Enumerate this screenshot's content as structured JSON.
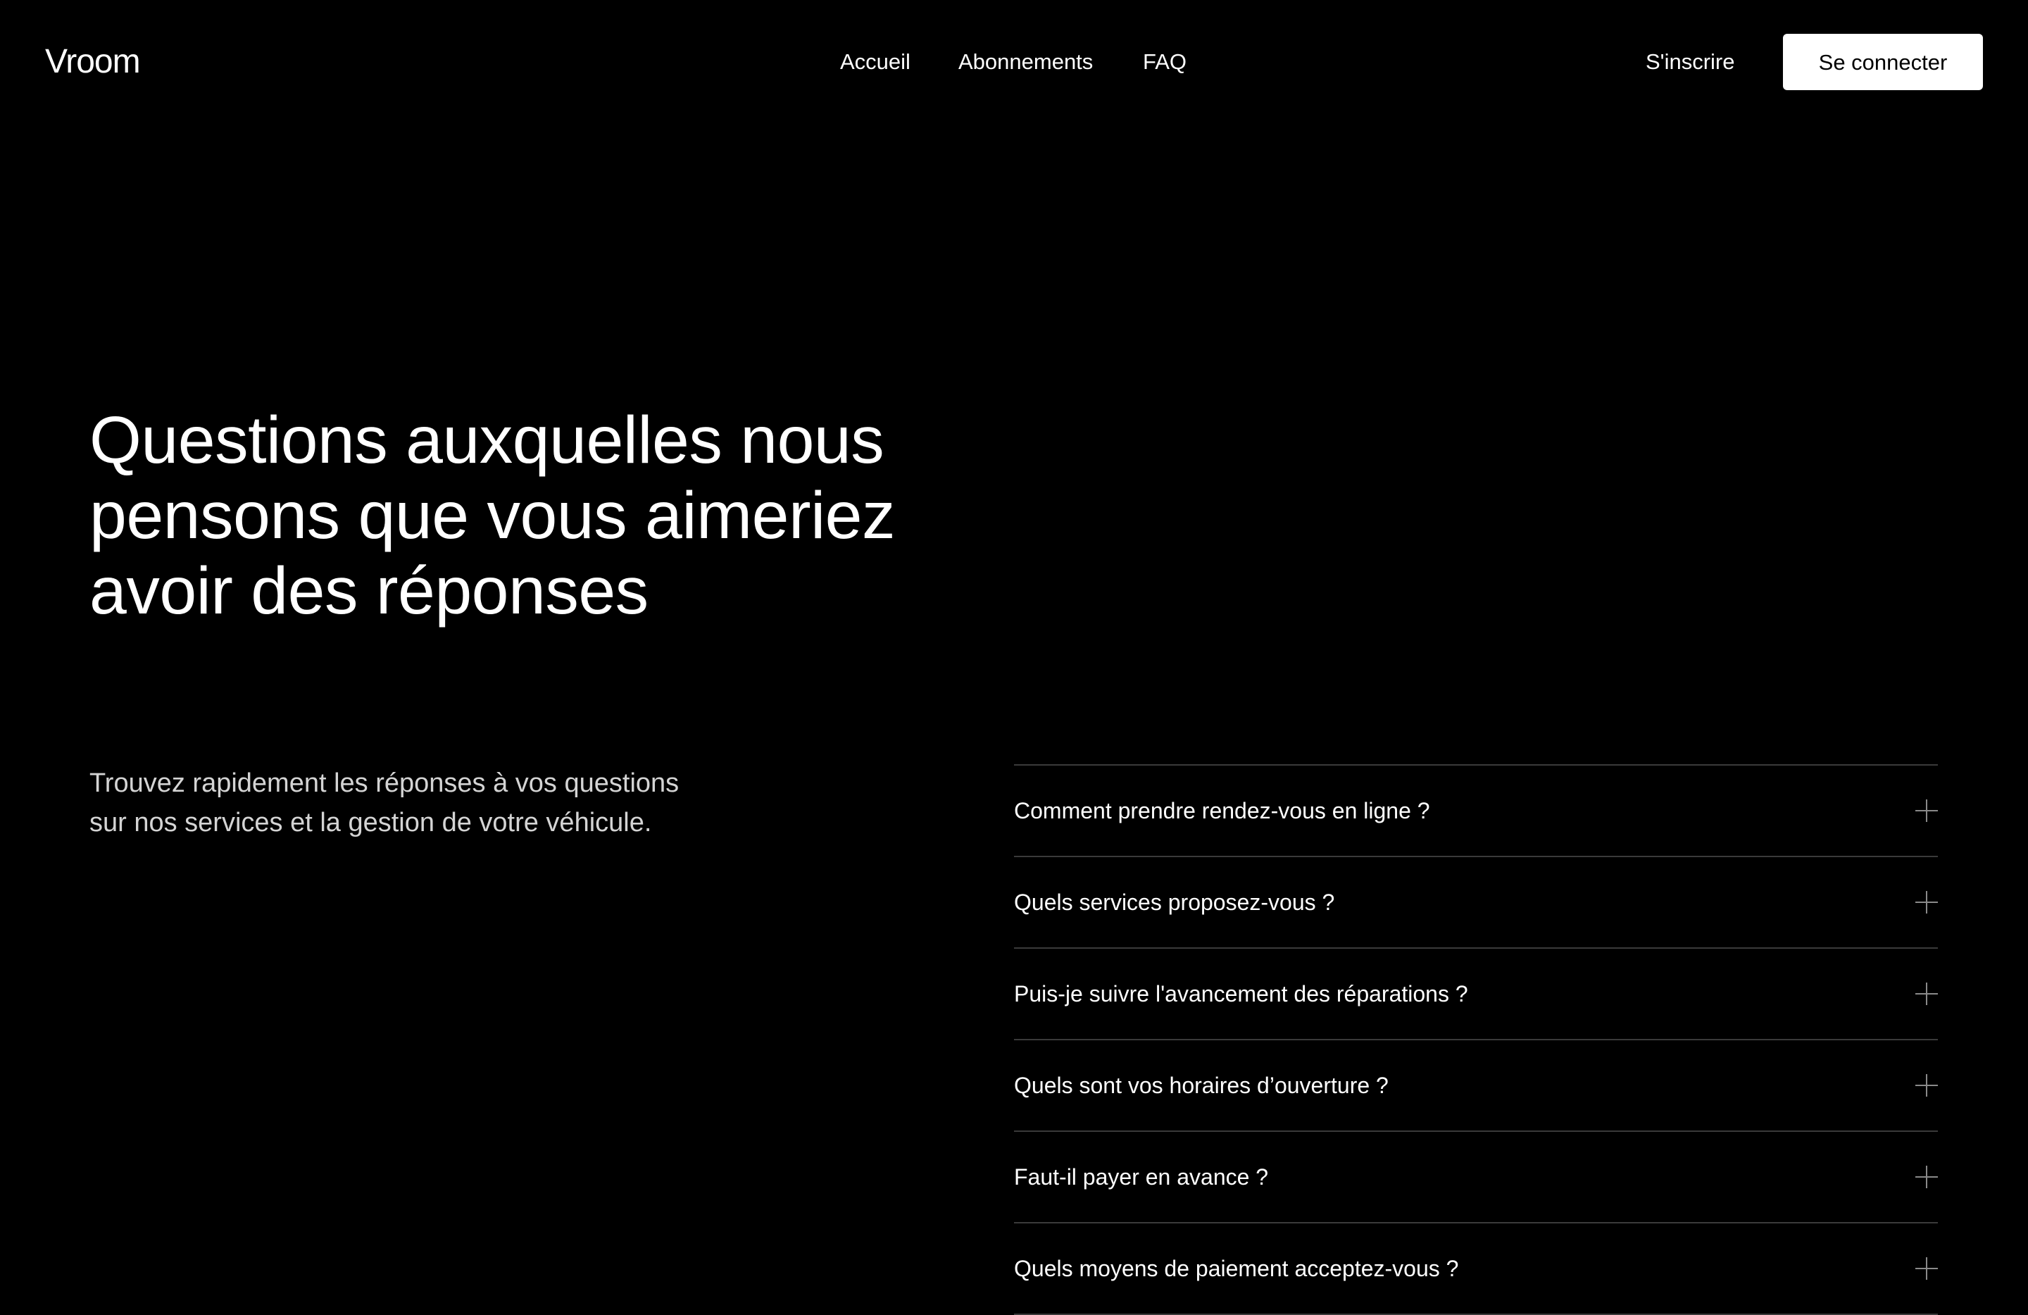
{
  "header": {
    "logo": "Vroom",
    "nav": [
      "Accueil",
      "Abonnements",
      "FAQ"
    ],
    "signup_label": "S'inscrire",
    "login_label": "Se connecter"
  },
  "hero": {
    "title": "Questions auxquelles nous pensons que vous aimeriez avoir des réponses",
    "intro": "Trouvez rapidement les réponses à vos questions sur nos services et la gestion de votre véhicule."
  },
  "faq": {
    "items": [
      {
        "question": "Comment prendre rendez-vous en ligne ?",
        "icon": "plus-icon"
      },
      {
        "question": "Quels services proposez-vous ?",
        "icon": "plus-icon"
      },
      {
        "question": "Puis-je suivre l'avancement des réparations ?",
        "icon": "plus-icon"
      },
      {
        "question": "Quels sont vos horaires d’ouverture ?",
        "icon": "plus-icon"
      },
      {
        "question": "Faut-il payer en avance ?",
        "icon": "plus-icon"
      },
      {
        "question": "Quels moyens de paiement acceptez-vous ?",
        "icon": "plus-icon"
      }
    ]
  },
  "colors": {
    "background": "#000000",
    "text": "#ffffff",
    "muted_text": "#d4d4d4",
    "divider": "#3a3a3a",
    "button_bg": "#ffffff",
    "button_text": "#000000"
  }
}
